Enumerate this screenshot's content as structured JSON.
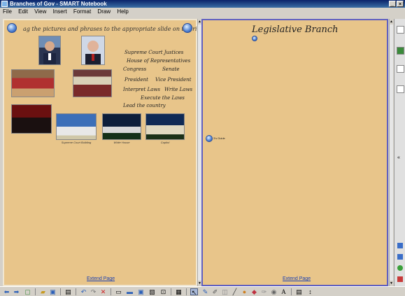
{
  "window": {
    "title": "Branches of Gov - SMART Notebook",
    "buttons": [
      "_",
      "×"
    ]
  },
  "menu": [
    "File",
    "Edit",
    "View",
    "Insert",
    "Format",
    "Draw",
    "Help"
  ],
  "left_page": {
    "instruction": "ag the pictures and phrases to the appropriate slide on the right.",
    "phrases": [
      "Supreme Court Justices",
      "House of Representatives",
      "Congress",
      "Senate",
      "President",
      "Vice President",
      "Interpret Laws",
      "Write Laws",
      "Execute the Laws",
      "Lead the country"
    ],
    "captions": {
      "supreme_court": "Supreme Court Building",
      "white_house": "White House",
      "capitol": "Capitol"
    },
    "extend_link": "Extend Page"
  },
  "right_page": {
    "heading": "Legislative Branch",
    "marker_label": "3's Guide",
    "extend_link": "Extend Page"
  },
  "icons": [
    "back-arrow-icon",
    "forward-arrow-icon",
    "new-page-icon",
    "open-folder-icon",
    "save-icon",
    "paste-icon",
    "undo-icon",
    "redo-icon",
    "delete-icon",
    "screen-icon",
    "display-icon",
    "capture-icon",
    "table-icon",
    "select-arrow-icon",
    "pen-icon",
    "creative-pen-icon",
    "eraser-icon",
    "line-icon",
    "fill-icon",
    "magic-pen-icon",
    "text-icon",
    "properties-icon"
  ],
  "colors": {
    "page_bg": "#e8c58a",
    "selected_border": "#6060c0",
    "link": "#1a3fb0"
  }
}
